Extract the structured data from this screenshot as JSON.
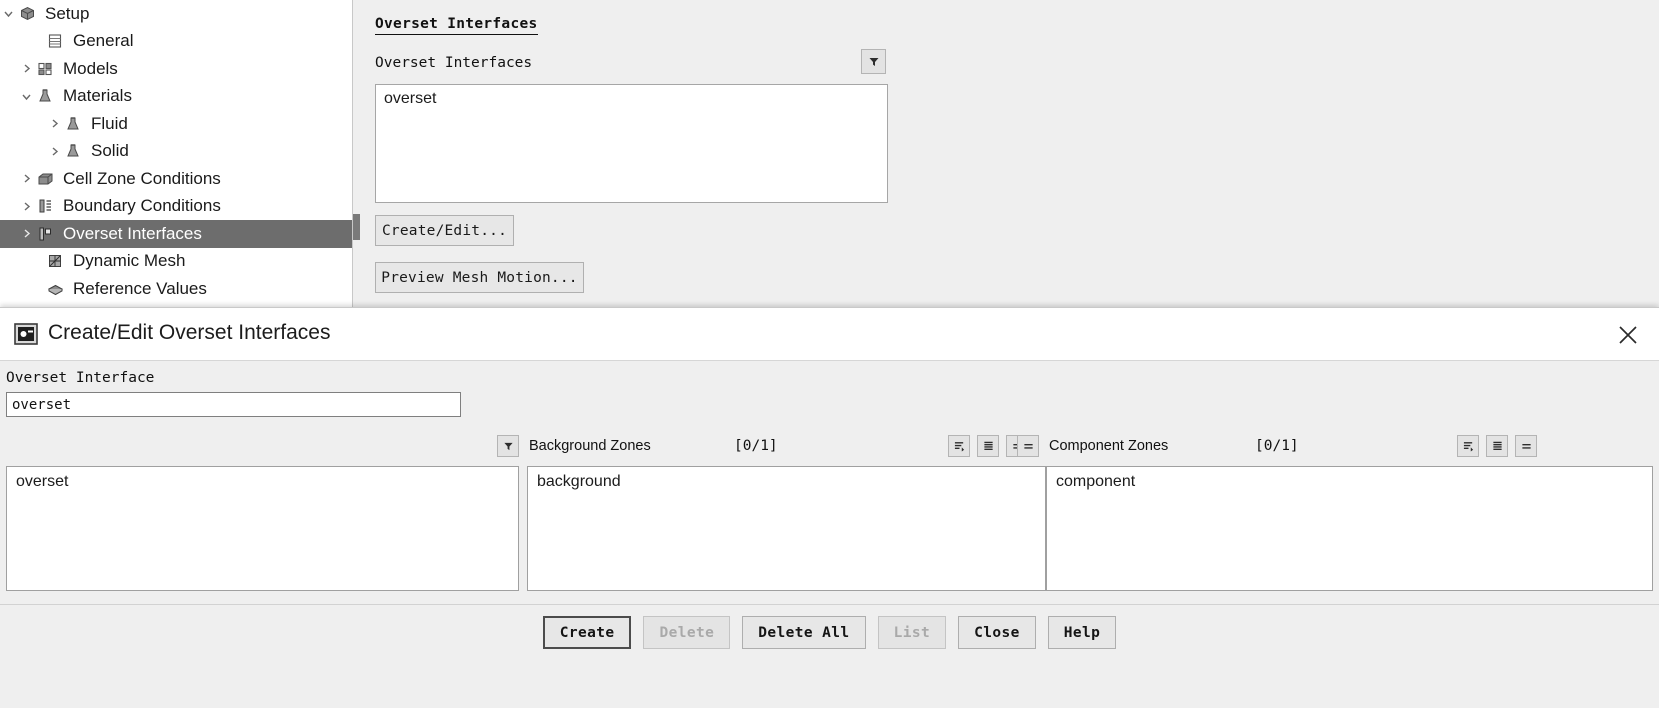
{
  "outline_tree": {
    "items": [
      {
        "label": "Setup",
        "indent": 0,
        "twisty": "chevron-down",
        "icon": "setup-icon",
        "selected": false
      },
      {
        "label": "General",
        "indent": 1,
        "twisty": "none",
        "icon": "general-icon",
        "selected": false
      },
      {
        "label": "Models",
        "indent": 1,
        "twisty": "chevron-right",
        "icon": "models-icon",
        "selected": false
      },
      {
        "label": "Materials",
        "indent": 1,
        "twisty": "chevron-down",
        "icon": "materials-icon",
        "selected": false
      },
      {
        "label": "Fluid",
        "indent": 2,
        "twisty": "chevron-right",
        "icon": "fluid-icon",
        "selected": false
      },
      {
        "label": "Solid",
        "indent": 2,
        "twisty": "chevron-right",
        "icon": "solid-icon",
        "selected": false
      },
      {
        "label": "Cell Zone Conditions",
        "indent": 1,
        "twisty": "chevron-right",
        "icon": "cell-zone-icon",
        "selected": false
      },
      {
        "label": "Boundary Conditions",
        "indent": 1,
        "twisty": "chevron-right",
        "icon": "boundary-icon",
        "selected": false
      },
      {
        "label": "Overset Interfaces",
        "indent": 1,
        "twisty": "chevron-right",
        "icon": "overset-icon",
        "selected": true
      },
      {
        "label": "Dynamic Mesh",
        "indent": 1,
        "twisty": "none",
        "icon": "dynamic-mesh-icon",
        "selected": false
      },
      {
        "label": "Reference Values",
        "indent": 1,
        "twisty": "none",
        "icon": "reference-values-icon",
        "selected": false
      }
    ]
  },
  "task_page": {
    "title": "Overset Interfaces",
    "list_label": "Overset Interfaces",
    "filter_icon": "filter-icon",
    "list_items": [
      "overset"
    ],
    "create_edit_label": "Create/Edit...",
    "preview_mesh_motion_label": "Preview Mesh Motion..."
  },
  "dialog": {
    "title": "Create/Edit Overset Interfaces",
    "window_icon": "dialog-window-icon",
    "close_icon": "close-icon",
    "interface_name": {
      "label": "Overset Interface",
      "value": "overset"
    },
    "panels": {
      "overset": {
        "items": [
          "overset"
        ]
      },
      "background": {
        "header": "Background Zones",
        "count": "[0/1]",
        "filter_icon": "filter-icon",
        "items": [
          "background"
        ],
        "tools": [
          "sort-icon",
          "list-view-icon",
          "equal-icon"
        ]
      },
      "component": {
        "header": "Component Zones",
        "count": "[0/1]",
        "filter_icon": "equal-icon",
        "items": [
          "component"
        ],
        "tools": [
          "sort-icon",
          "list-view-icon",
          "equal-icon"
        ]
      }
    },
    "buttons": [
      {
        "label": "Create",
        "state": "focused"
      },
      {
        "label": "Delete",
        "state": "disabled"
      },
      {
        "label": "Delete All",
        "state": "normal"
      },
      {
        "label": "List",
        "state": "disabled"
      },
      {
        "label": "Close",
        "state": "normal"
      },
      {
        "label": "Help",
        "state": "normal"
      }
    ]
  },
  "colors": {
    "selection": "#6d6d6d",
    "panel_bg": "#efefef",
    "field_bg": "#ffffff",
    "border": "#a0a0a0"
  }
}
